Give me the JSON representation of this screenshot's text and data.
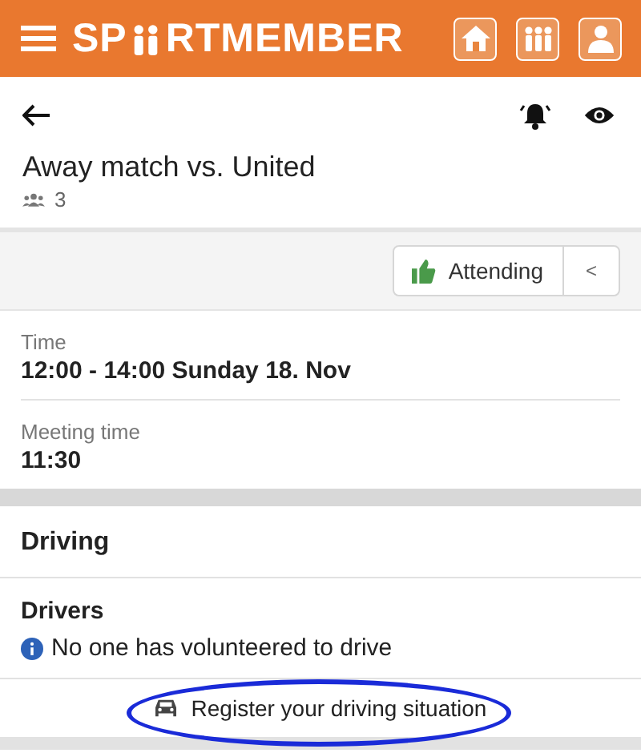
{
  "header": {
    "brand_start": "SP",
    "brand_end": "RTMEMBER"
  },
  "event": {
    "title": "Away match vs. United",
    "participants": "3",
    "notifications_on": true
  },
  "attendance": {
    "label": "Attending",
    "toggle": "<"
  },
  "details": [
    {
      "label": "Time",
      "value": "12:00 - 14:00 Sunday 18. Nov"
    },
    {
      "label": "Meeting time",
      "value": "11:30"
    }
  ],
  "driving": {
    "heading": "Driving",
    "drivers_label": "Drivers",
    "notice": "No one has volunteered to drive",
    "action": "Register your driving situation",
    "highlighted": true
  }
}
